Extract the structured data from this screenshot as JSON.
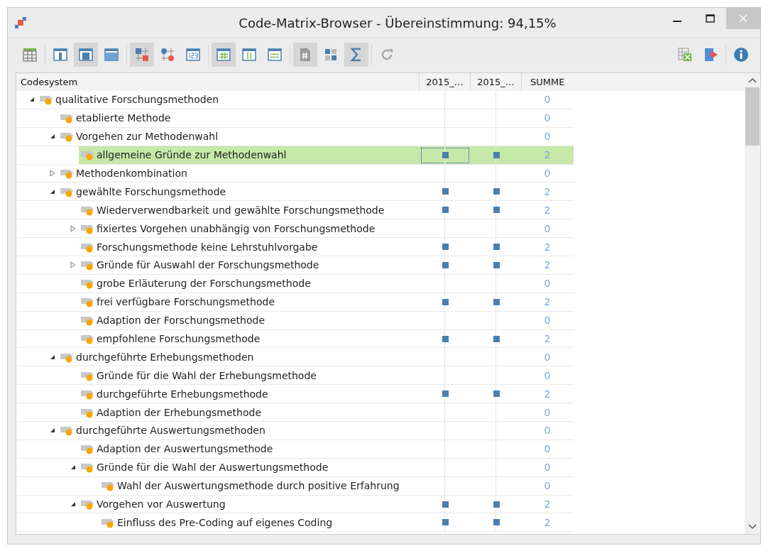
{
  "window": {
    "title": "Code-Matrix-Browser - Übereinstimmung: 94,15%"
  },
  "toolbar": [
    {
      "kind": "table",
      "pressed": false
    },
    {
      "kind": "sep"
    },
    {
      "kind": "layout-narrow",
      "pressed": false
    },
    {
      "kind": "layout-mid",
      "pressed": true
    },
    {
      "kind": "layout-wide",
      "pressed": false
    },
    {
      "kind": "sep"
    },
    {
      "kind": "squares",
      "pressed": true
    },
    {
      "kind": "circles",
      "pressed": false
    },
    {
      "kind": "numbers",
      "pressed": false
    },
    {
      "kind": "sep"
    },
    {
      "kind": "grid",
      "pressed": true
    },
    {
      "kind": "columns",
      "pressed": false
    },
    {
      "kind": "rows",
      "pressed": false
    },
    {
      "kind": "sep"
    },
    {
      "kind": "hash",
      "pressed": true
    },
    {
      "kind": "tiles",
      "pressed": false
    },
    {
      "kind": "sigma",
      "pressed": true
    },
    {
      "kind": "sep"
    },
    {
      "kind": "refresh",
      "pressed": false
    }
  ],
  "toolbar_right": [
    {
      "kind": "excel"
    },
    {
      "kind": "export"
    },
    {
      "kind": "sep"
    },
    {
      "kind": "info"
    }
  ],
  "table": {
    "columns": [
      "Codesystem",
      "2015_…",
      "2015_…",
      "SUMME"
    ],
    "rows": [
      {
        "label": "qualitative Forschungsmethoden",
        "c1": false,
        "c2": false,
        "sum": "0",
        "selected": false,
        "expanded": true,
        "children": [
          {
            "label": "etablierte Methode",
            "c1": false,
            "c2": false,
            "sum": "0",
            "selected": false
          },
          {
            "label": "Vorgehen zur Methodenwahl",
            "c1": false,
            "c2": false,
            "sum": "0",
            "selected": false,
            "expanded": true,
            "children": [
              {
                "label": "allgemeine Gründe zur Methodenwahl",
                "c1": true,
                "c2": true,
                "sum": "2",
                "selected": true
              }
            ]
          },
          {
            "label": "Methodenkombination",
            "c1": false,
            "c2": false,
            "sum": "0",
            "selected": false,
            "expanded": false
          },
          {
            "label": "gewählte Forschungsmethode",
            "c1": true,
            "c2": true,
            "sum": "2",
            "selected": false,
            "expanded": true,
            "children": [
              {
                "label": "Wiederverwendbarkeit und gewählte Forschungsmethode",
                "c1": true,
                "c2": true,
                "sum": "2",
                "selected": false
              },
              {
                "label": "fixiertes Vorgehen unabhängig von Forschungsmethode",
                "c1": false,
                "c2": false,
                "sum": "0",
                "selected": false,
                "expanded": false
              },
              {
                "label": "Forschungsmethode keine Lehrstuhlvorgabe",
                "c1": true,
                "c2": true,
                "sum": "2",
                "selected": false
              },
              {
                "label": "Gründe für Auswahl der Forschungsmethode",
                "c1": true,
                "c2": true,
                "sum": "2",
                "selected": false,
                "expanded": false
              },
              {
                "label": "grobe Erläuterung der Forschungsmethode",
                "c1": false,
                "c2": false,
                "sum": "0",
                "selected": false
              },
              {
                "label": "frei verfügbare Forschungsmethode",
                "c1": true,
                "c2": true,
                "sum": "2",
                "selected": false
              },
              {
                "label": "Adaption der Forschungsmethode",
                "c1": false,
                "c2": false,
                "sum": "0",
                "selected": false
              },
              {
                "label": "empfohlene Forschungsmethode",
                "c1": true,
                "c2": true,
                "sum": "2",
                "selected": false
              }
            ]
          },
          {
            "label": "durchgeführte Erhebungsmethoden",
            "c1": false,
            "c2": false,
            "sum": "0",
            "selected": false,
            "expanded": true,
            "children": [
              {
                "label": "Gründe für die Wahl der Erhebungsmethode",
                "c1": false,
                "c2": false,
                "sum": "0",
                "selected": false
              },
              {
                "label": "durchgeführte Erhebungsmethode",
                "c1": true,
                "c2": true,
                "sum": "2",
                "selected": false
              },
              {
                "label": "Adaption der Erhebungsmethode",
                "c1": false,
                "c2": false,
                "sum": "0",
                "selected": false
              }
            ]
          },
          {
            "label": "durchgeführte Auswertungsmethoden",
            "c1": false,
            "c2": false,
            "sum": "0",
            "selected": false,
            "expanded": true,
            "children": [
              {
                "label": "Adaption der Auswertungsmethode",
                "c1": false,
                "c2": false,
                "sum": "0",
                "selected": false
              },
              {
                "label": "Gründe für die Wahl der Auswertungsmethode",
                "c1": false,
                "c2": false,
                "sum": "0",
                "selected": false,
                "expanded": true,
                "children": [
                  {
                    "label": "Wahl der Auswertungsmethode durch positive Erfahrung",
                    "c1": false,
                    "c2": false,
                    "sum": "0",
                    "selected": false
                  }
                ]
              },
              {
                "label": "Vorgehen vor Auswertung",
                "c1": true,
                "c2": true,
                "sum": "2",
                "selected": false,
                "expanded": true,
                "children": [
                  {
                    "label": "Einfluss des Pre-Coding auf eigenes Coding",
                    "c1": true,
                    "c2": true,
                    "sum": "2",
                    "selected": false
                  }
                ]
              }
            ]
          }
        ]
      }
    ]
  }
}
